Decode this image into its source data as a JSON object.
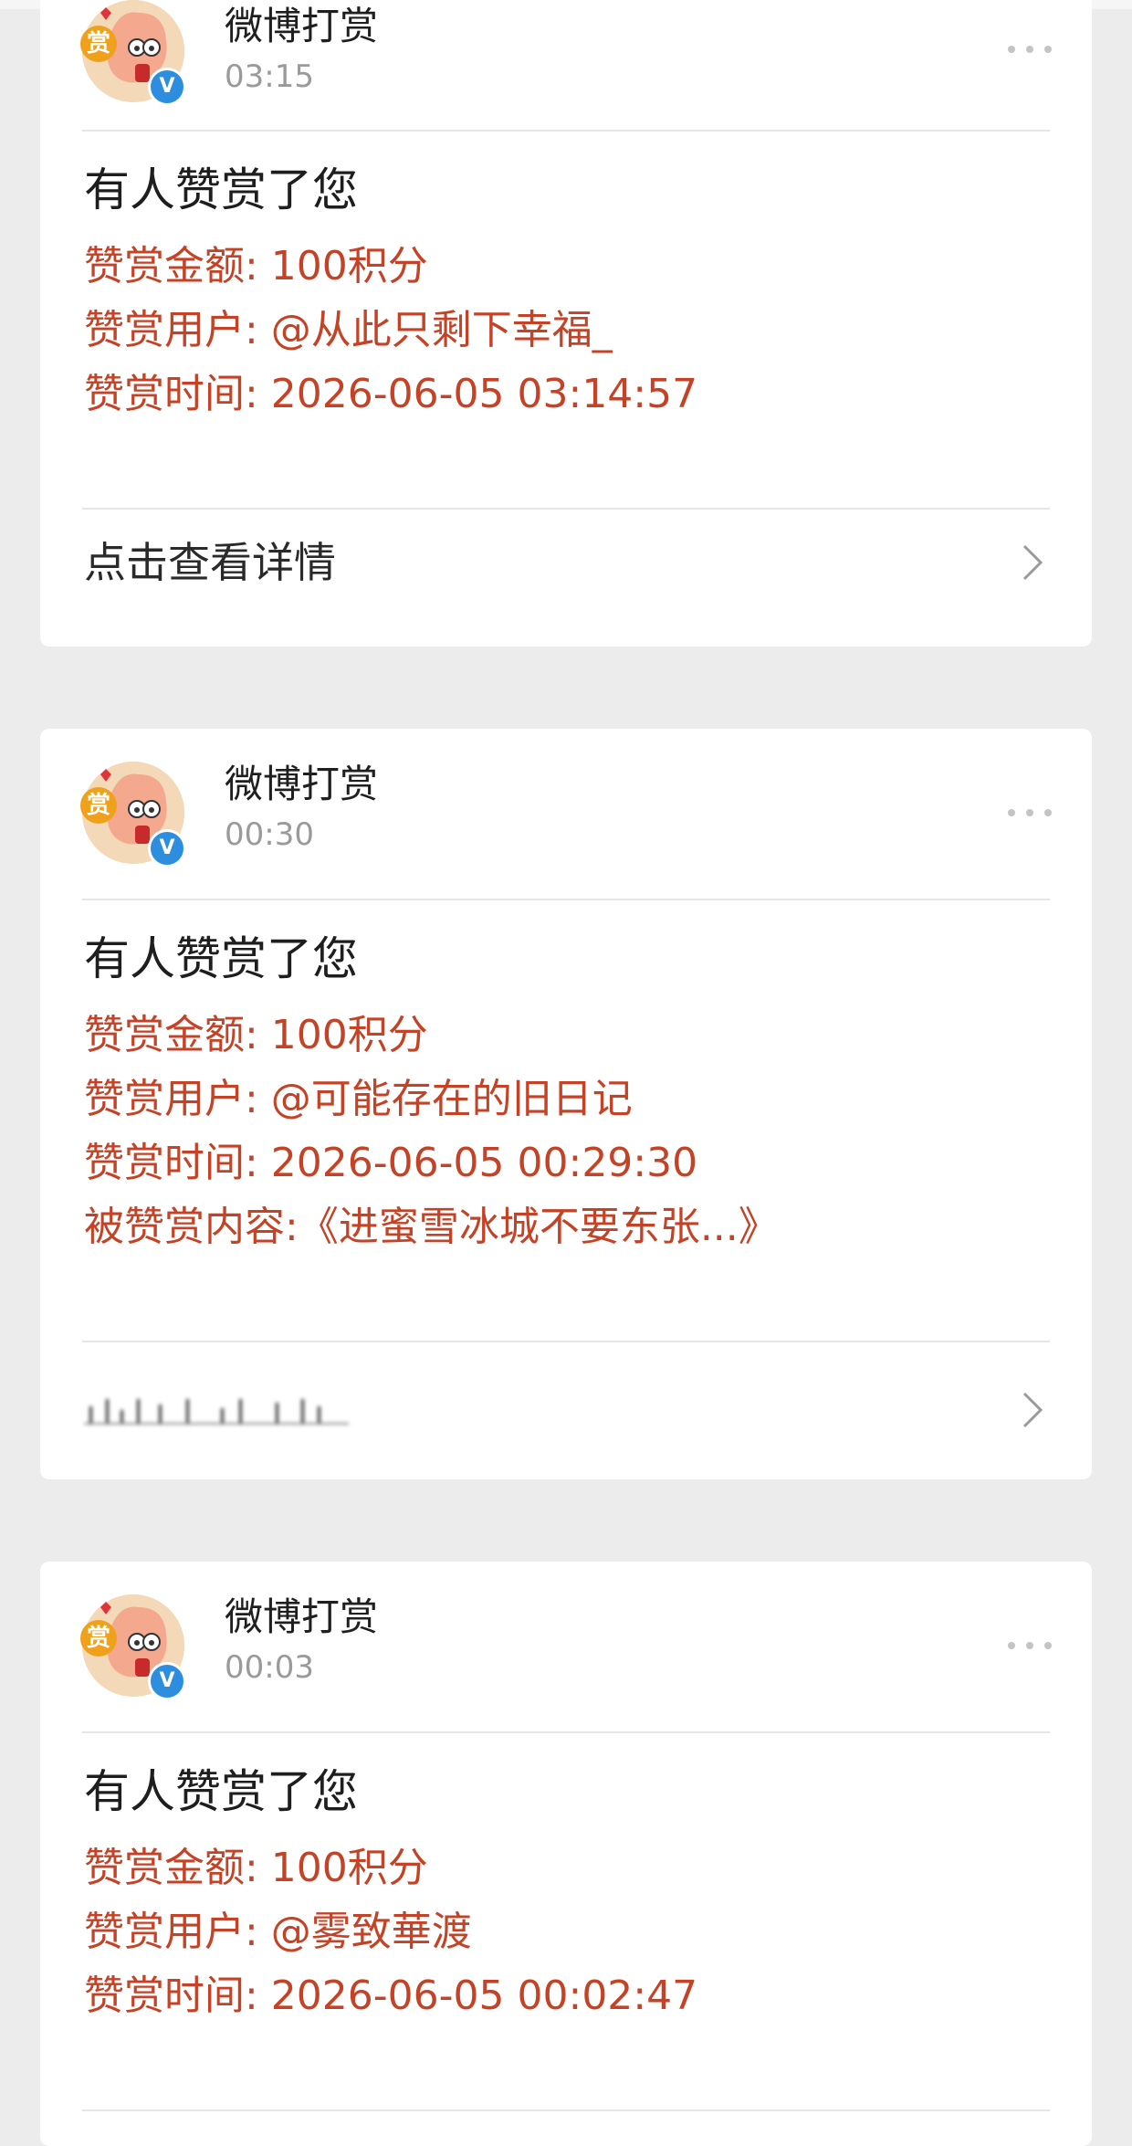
{
  "notifications": [
    {
      "sender": "微博打赏",
      "time": "03:15",
      "title": "有人赞赏了您",
      "amount": "赞赏金额: 100积分",
      "user": "赞赏用户: @从此只剩下幸福_",
      "reward_time": "赞赏时间: 2026-06-05 03:14:57",
      "footer": "点击查看详情"
    },
    {
      "sender": "微博打赏",
      "time": "00:30",
      "title": "有人赞赏了您",
      "amount": "赞赏金额: 100积分",
      "user": "赞赏用户: @可能存在的旧日记",
      "reward_time": "赞赏时间: 2026-06-05 00:29:30",
      "content": "被赞赏内容:《进蜜雪冰城不要东张...》",
      "footer": ""
    },
    {
      "sender": "微博打赏",
      "time": "00:03",
      "title": "有人赞赏了您",
      "amount": "赞赏金额: 100积分",
      "user": "赞赏用户: @雾致華渡",
      "reward_time": "赞赏时间: 2026-06-05 00:02:47"
    }
  ],
  "icons": {
    "avatar_badge_text": "赏",
    "verified_badge_text": "V",
    "more": "more-icon",
    "chevron": "chevron-right-icon"
  },
  "colors": {
    "accent_red": "#c44326",
    "verified_blue": "#2d8ee0",
    "badge_orange": "#f0a11c"
  }
}
